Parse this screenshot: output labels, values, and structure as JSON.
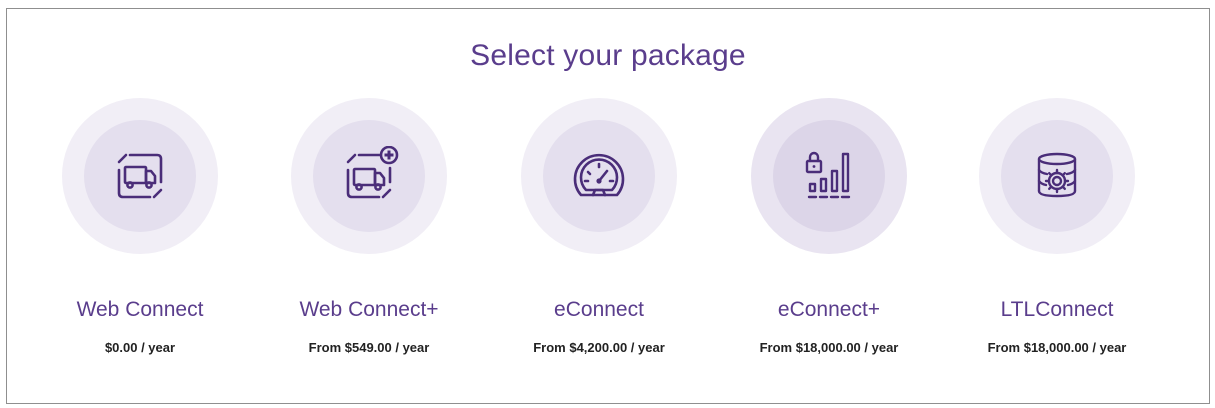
{
  "page": {
    "title": "Select your package"
  },
  "colors": {
    "accent": "#5a3d8c",
    "circle_outer": "#f1eef6",
    "circle_inner": "#e4dfee",
    "price_text": "#222222"
  },
  "packages": [
    {
      "name": "Web Connect",
      "price": "$0.00 / year",
      "icon": "truck-box-icon"
    },
    {
      "name": "Web Connect+",
      "price": "From $549.00 / year",
      "icon": "truck-box-plus-icon"
    },
    {
      "name": "eConnect",
      "price": "From $4,200.00 / year",
      "icon": "speedometer-icon"
    },
    {
      "name": "eConnect+",
      "price": "From $18,000.00 / year",
      "icon": "lock-bar-chart-icon"
    },
    {
      "name": "LTLConnect",
      "price": "From $18,000.00 / year",
      "icon": "database-gear-icon"
    }
  ]
}
